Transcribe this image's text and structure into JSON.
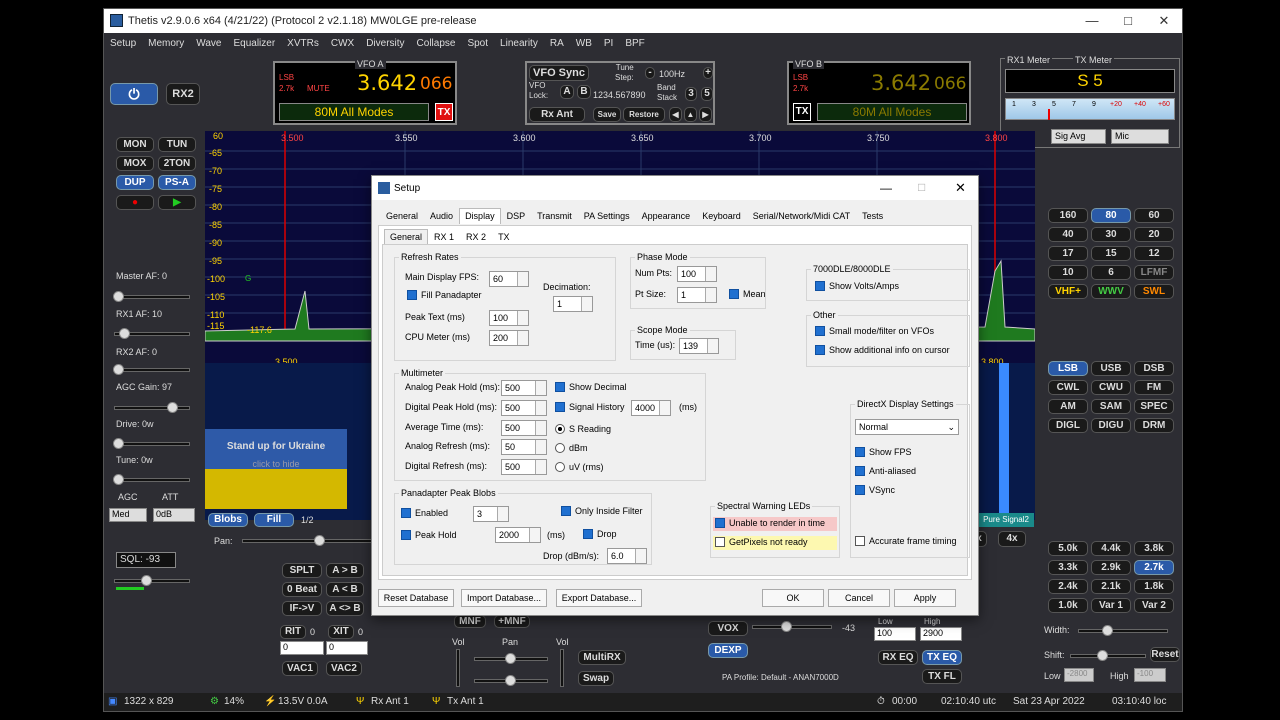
{
  "window": {
    "title": "Thetis v2.9.0.6 x64 (4/21/22) (Protocol 2 v2.1.18) MW0LGE pre-release"
  },
  "menu": [
    "Setup",
    "Memory",
    "Wave",
    "Equalizer",
    "XVTRs",
    "CWX",
    "Diversity",
    "Collapse",
    "Spot",
    "Linearity",
    "RA",
    "WB",
    "PI",
    "BPF"
  ],
  "vfoA": {
    "label": "VFO A",
    "mode": "LSB",
    "bw": "2.7k",
    "mute": "MUTE",
    "freq": "3.642",
    "sub": "066",
    "band": "80M All Modes",
    "tx": "TX"
  },
  "vfoB": {
    "label": "VFO B",
    "mode": "LSB",
    "bw": "2.7k",
    "freq": "3.642",
    "sub": "066",
    "band": "80M All Modes",
    "tx": "TX"
  },
  "vfoSync": {
    "sync": "VFO Sync",
    "lock": "VFO\nLock:",
    "a": "A",
    "b": "B",
    "lockVal": "1234.567890",
    "tune": "Tune\nStep:",
    "step": "100Hz",
    "bandstack": "Band\nStack",
    "bs1": "3",
    "bs2": "5",
    "rxant": "Rx Ant",
    "save": "Save",
    "restore": "Restore"
  },
  "meter": {
    "rx": "RX1 Meter",
    "tx": "TX Meter",
    "reading": "S 5",
    "scale": [
      "1",
      "3",
      "5",
      "7",
      "9",
      "+20",
      "+40",
      "+60"
    ],
    "sel1": "Sig Avg",
    "sel2": "Mic"
  },
  "left": {
    "rx2": "RX2",
    "mon": "MON",
    "tun": "TUN",
    "mox": "MOX",
    "tton": "2TON",
    "dup": "DUP",
    "psa": "PS-A",
    "masteraf": "Master AF:  0",
    "rx1af": "RX1 AF:  10",
    "rx2af": "RX2 AF:  0",
    "agcgain": "AGC Gain:  97",
    "drive": "Drive:  0w",
    "tune": "Tune:  0w",
    "agc": "AGC",
    "att": "ATT",
    "agcVal": "Med",
    "attVal": "0dB",
    "sql": "SQL: -93"
  },
  "spectrum": {
    "freqs": [
      "3.500",
      "3.550",
      "3.600",
      "3.650",
      "3.700",
      "3.750",
      "3.800"
    ],
    "db": [
      "60",
      "-65",
      "-70",
      "-75",
      "-80",
      "-85",
      "-90",
      "-95",
      "-100",
      "-105",
      "-110",
      "-115"
    ],
    "peak": "-117.6",
    "wfLow": "3.500",
    "wfHigh": "3.800",
    "g": "G"
  },
  "banner": {
    "title": "Stand up for Ukraine",
    "sub": "click to hide"
  },
  "wfbar": {
    "blobs": "Blobs",
    "fill": "Fill",
    "page": "1/2",
    "pan": "Pan:",
    "pure": "Pure Signal2",
    "x": "x",
    "x4": "4x"
  },
  "bands": [
    "160",
    "80",
    "60",
    "40",
    "30",
    "20",
    "17",
    "15",
    "12",
    "10",
    "6",
    "LFMF",
    "VHF+",
    "WWV",
    "SWL"
  ],
  "modes": [
    "LSB",
    "USB",
    "DSB",
    "CWL",
    "CWU",
    "FM",
    "AM",
    "SAM",
    "SPEC",
    "DIGL",
    "DIGU",
    "DRM"
  ],
  "filters": [
    "5.0k",
    "4.4k",
    "3.8k",
    "3.3k",
    "2.9k",
    "2.7k",
    "2.4k",
    "2.1k",
    "1.8k",
    "1.0k",
    "Var 1",
    "Var 2"
  ],
  "bottom": {
    "splt": "SPLT",
    "ab": "A > B",
    "zbeat": "0 Beat",
    "ba": "A < B",
    "ifv": "IF->V",
    "aswap": "A <> B",
    "rit": "RIT",
    "ritv": "0",
    "xit": "XIT",
    "xitv": "0",
    "ritn": "0",
    "xitn": "0",
    "vac1": "VAC1",
    "vac2": "VAC2",
    "mnf": "MNF",
    "pmnf": "+MNF",
    "vol": "Vol",
    "pan": "Pan",
    "multirx": "MultiRX",
    "swap": "Swap",
    "vox": "VOX",
    "voxv": "-43",
    "dexp": "DEXP",
    "low": "Low",
    "high": "High",
    "lowv": "100",
    "highv": "2900",
    "rxeq": "RX EQ",
    "txeq": "TX EQ",
    "txfl": "TX FL",
    "paprofile": "PA Profile: Default - ANAN7000D",
    "width": "Width:",
    "shift": "Shift:",
    "reset": "Reset",
    "lowr": "-2800",
    "highr": "-100",
    "lowl": "Low",
    "highl": "High"
  },
  "status": {
    "res": "1322 x 829",
    "cpu": "14%",
    "volt": "13.5V  0.0A",
    "rxant": "Rx Ant 1",
    "txant": "Tx Ant 1",
    "timer": "00:00",
    "utc": "02:10:40 utc",
    "date": "Sat 23 Apr 2022",
    "loc": "03:10:40 loc"
  },
  "setup": {
    "title": "Setup",
    "tabs": [
      "General",
      "Audio",
      "Display",
      "DSP",
      "Transmit",
      "PA Settings",
      "Appearance",
      "Keyboard",
      "Serial/Network/Midi CAT",
      "Tests"
    ],
    "subtabs": [
      "General",
      "RX 1",
      "RX 2",
      "TX"
    ],
    "refresh": {
      "title": "Refresh Rates",
      "fps": "Main Display FPS:",
      "fpsv": "60",
      "fill": "Fill Panadapter",
      "decim": "Decimation:",
      "decimv": "1",
      "peak": "Peak Text (ms)",
      "peakv": "100",
      "cpu": "CPU Meter (ms)",
      "cpuv": "200"
    },
    "phase": {
      "title": "Phase Mode",
      "numpts": "Num Pts:",
      "numptsv": "100",
      "psize": "Pt Size:",
      "psizev": "1",
      "mean": "Mean"
    },
    "scope": {
      "title": "Scope Mode",
      "time": "Time (us):",
      "timev": "139"
    },
    "dle": {
      "title": "7000DLE/8000DLE",
      "volts": "Show Volts/Amps"
    },
    "other": {
      "title": "Other",
      "small": "Small mode/filter on VFOs",
      "addl": "Show additional info on cursor"
    },
    "multimeter": {
      "title": "Multimeter",
      "aph": "Analog Peak Hold (ms):",
      "aphv": "500",
      "dph": "Digital Peak Hold (ms):",
      "dphv": "500",
      "avg": "Average Time (ms):",
      "avgv": "500",
      "ar": "Analog Refresh (ms):",
      "arv": "50",
      "dr": "Digital Refresh (ms):",
      "drv": "500",
      "showdec": "Show Decimal",
      "sighist": "Signal History",
      "sighistv": "4000",
      "ms": "(ms)",
      "sread": "S Reading",
      "dbm": "dBm",
      "uv": "uV (rms)"
    },
    "directx": {
      "title": "DirectX Display Settings",
      "mode": "Normal",
      "fps": "Show FPS",
      "aa": "Anti-aliased",
      "vsync": "VSync",
      "aft": "Accurate frame timing"
    },
    "blobs": {
      "title": "Panadapter Peak Blobs",
      "enabled": "Enabled",
      "enabledv": "3",
      "onlyin": "Only Inside Filter",
      "peakhold": "Peak Hold",
      "peakholdv": "2000",
      "ms": "(ms)",
      "drop": "Drop",
      "dropdbm": "Drop (dBm/s):",
      "dropdbmv": "6.0"
    },
    "leds": {
      "title": "Spectral Warning LEDs",
      "unable": "Unable to render in time",
      "getpix": "GetPixels not ready"
    },
    "buttons": {
      "reset": "Reset Database",
      "import": "Import Database...",
      "export": "Export Database...",
      "ok": "OK",
      "cancel": "Cancel",
      "apply": "Apply"
    }
  }
}
